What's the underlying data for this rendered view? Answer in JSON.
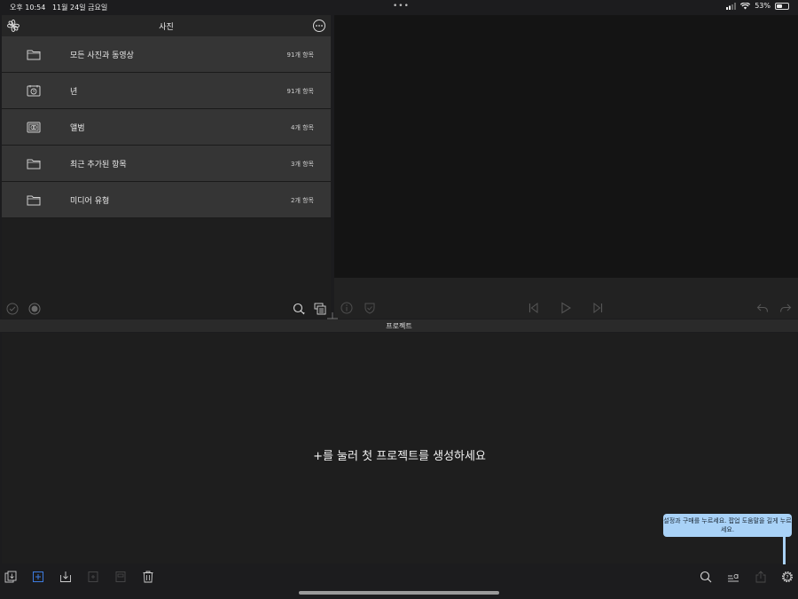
{
  "status_bar": {
    "time": "오후 10:54",
    "date": "11월 24일 금요일",
    "multitask_dots": "•••",
    "battery_percent": "53%",
    "battery_level": 0.53
  },
  "photos_panel": {
    "title": "사진",
    "rows": [
      {
        "label": "모든 사진과 동영상",
        "count": "91개 항목",
        "icon": "folder-icon"
      },
      {
        "label": "년",
        "count": "91개 항목",
        "icon": "calendar-clock-icon"
      },
      {
        "label": "앨범",
        "count": "4개 항목",
        "icon": "album-icon"
      },
      {
        "label": "최근 추가된 항목",
        "count": "3개 항목",
        "icon": "folder-icon"
      },
      {
        "label": "미디어 유형",
        "count": "2개 항목",
        "icon": "folder-icon"
      }
    ]
  },
  "project": {
    "header_title": "프로젝트",
    "empty_message": "+를 눌러 첫 프로젝트를 생성하세요"
  },
  "tooltip": {
    "text": "설정과 구매를 누르세요. 팝업 도움말을 길게 누르세요."
  },
  "colors": {
    "accent": "#3d7be0",
    "tooltip_bg": "#a9d2f7",
    "row_bg": "#353535"
  }
}
